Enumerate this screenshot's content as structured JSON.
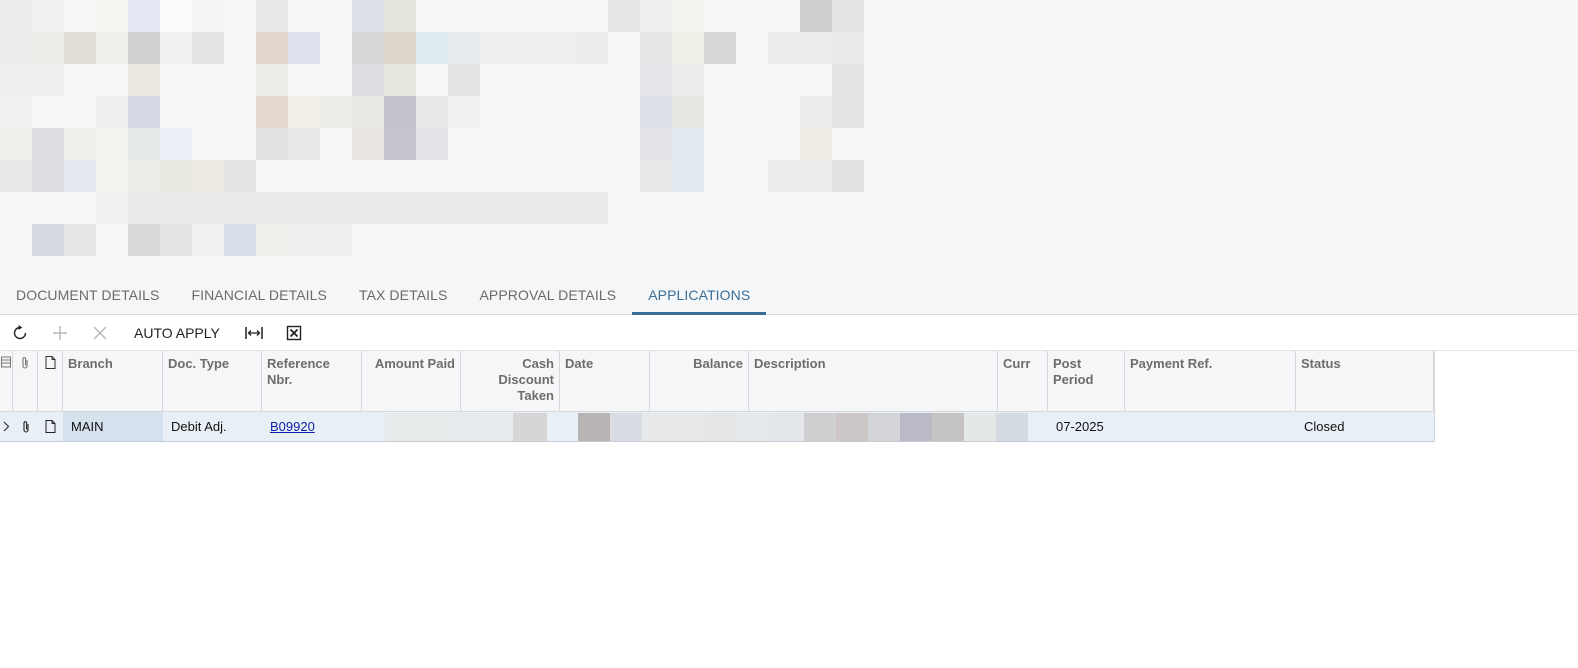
{
  "tabs": [
    {
      "label": "DOCUMENT DETAILS",
      "active": false
    },
    {
      "label": "FINANCIAL DETAILS",
      "active": false
    },
    {
      "label": "TAX DETAILS",
      "active": false
    },
    {
      "label": "APPROVAL DETAILS",
      "active": false
    },
    {
      "label": "APPLICATIONS",
      "active": true
    }
  ],
  "toolbar": {
    "refresh_icon": "refresh-icon",
    "add_icon": "plus-icon",
    "delete_icon": "close-icon",
    "auto_apply_label": "AUTO APPLY",
    "fit_icon": "fit-width-icon",
    "excel_icon": "excel-export-icon"
  },
  "grid": {
    "columns": {
      "branch": "Branch",
      "doc_type": "Doc. Type",
      "reference_nbr": "Reference Nbr.",
      "amount_paid": "Amount Paid",
      "cash_discount": "Cash Discount Taken",
      "date": "Date",
      "balance": "Balance",
      "description": "Description",
      "curr": "Curr",
      "post_period": "Post Period",
      "payment_ref": "Payment Ref.",
      "status": "Status"
    },
    "rows": [
      {
        "branch": "MAIN",
        "doc_type": "Debit Adj.",
        "reference_nbr": "B09920",
        "post_period": "07-2025",
        "payment_ref": "",
        "status": "Closed"
      }
    ]
  },
  "colors": {
    "accent": "#3a6f99",
    "link": "#0a1ea8",
    "row_highlight": "#e9eff6"
  }
}
